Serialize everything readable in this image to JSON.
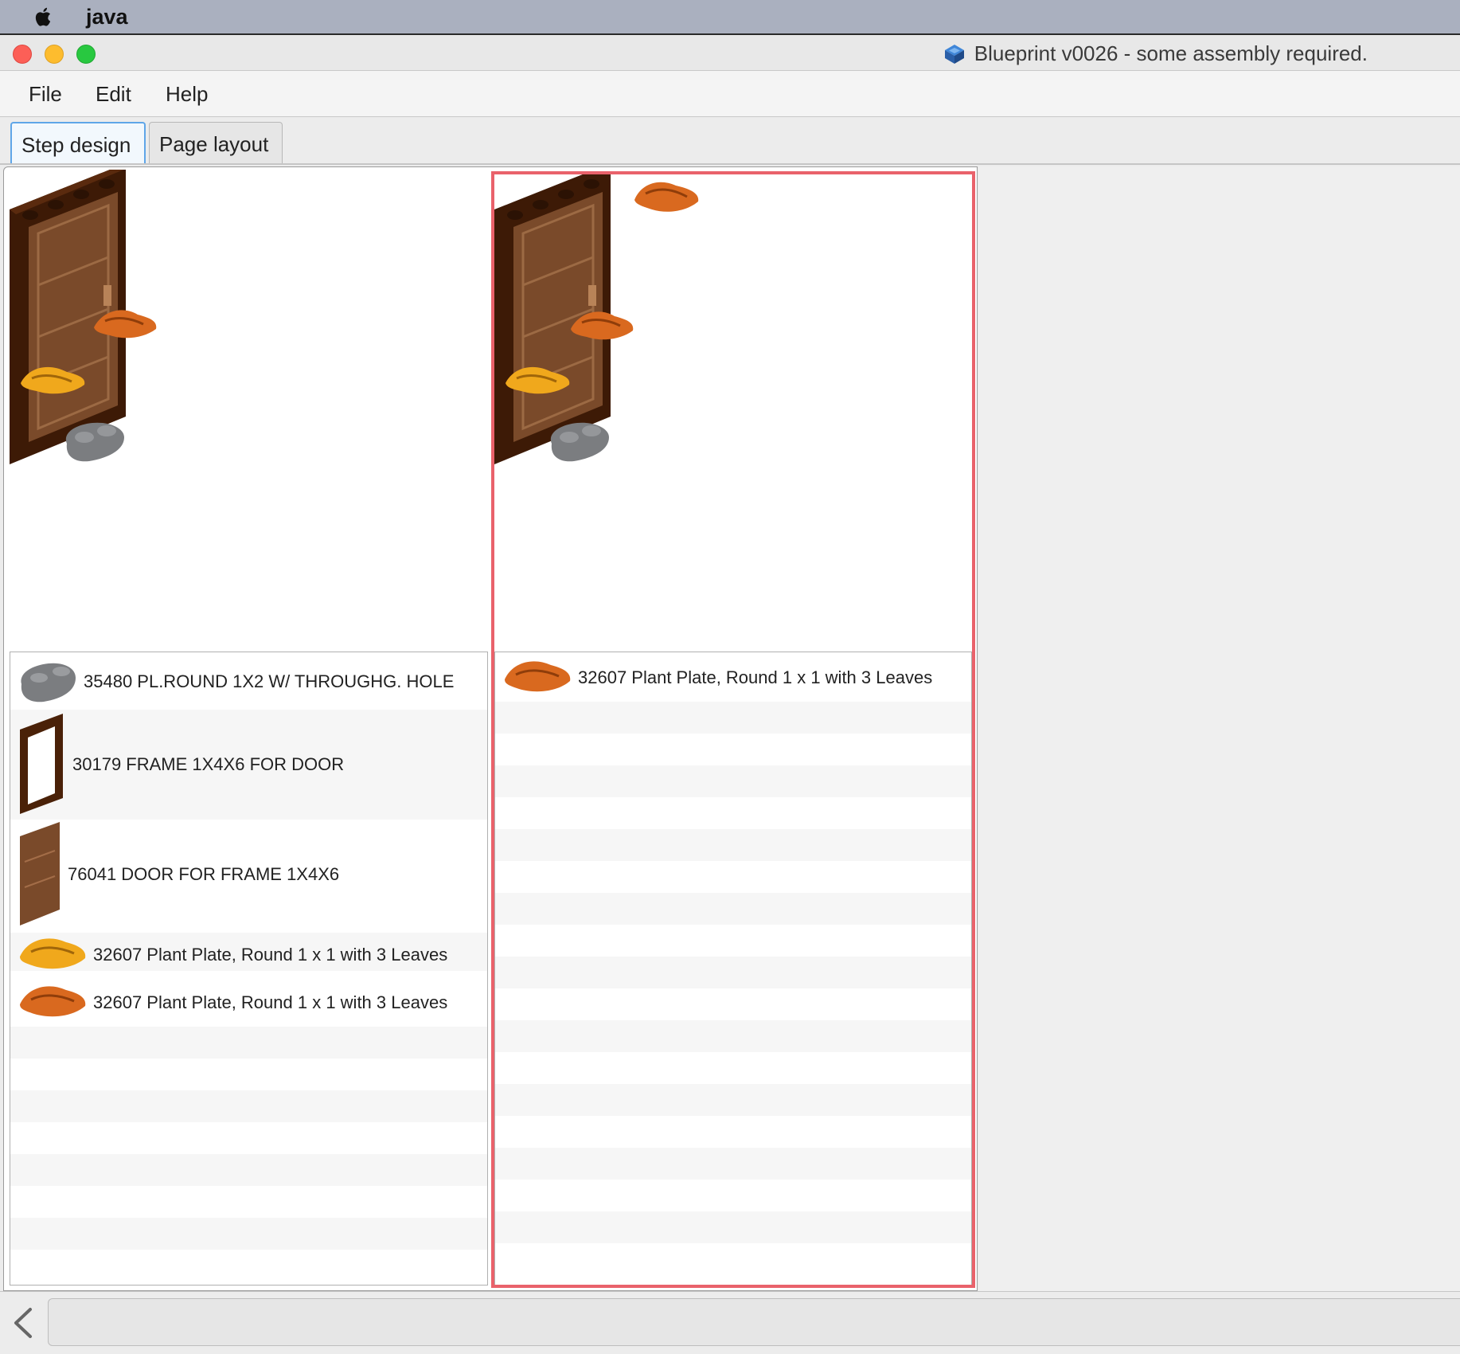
{
  "menubar": {
    "app_name": "java"
  },
  "window": {
    "title": "Blueprint v0026 - some assembly required."
  },
  "menu": {
    "file": "File",
    "edit": "Edit",
    "help": "Help"
  },
  "tabs": [
    {
      "label": "Step design",
      "active": true
    },
    {
      "label": "Page layout",
      "active": false
    }
  ],
  "steps": [
    {
      "parts": [
        {
          "icon": "round-plate-icon",
          "label": "35480 PL.ROUND 1X2 W/ THROUGHG. HOLE"
        },
        {
          "icon": "door-frame-icon",
          "label": "30179 FRAME 1X4X6 FOR DOOR"
        },
        {
          "icon": "door-icon",
          "label": "76041 DOOR FOR FRAME 1X4X6"
        },
        {
          "icon": "plant-leaves-yellow-icon",
          "label": "32607 Plant Plate, Round 1 x 1 with 3 Leaves"
        },
        {
          "icon": "plant-leaves-orange-icon",
          "label": "32607 Plant Plate, Round 1 x 1 with 3 Leaves"
        }
      ]
    },
    {
      "selected": true,
      "parts": [
        {
          "icon": "plant-leaves-orange-icon",
          "label": "32607 Plant Plate, Round 1 x 1 with 3 Leaves"
        }
      ]
    }
  ],
  "colors": {
    "selection": "#e9626b",
    "tab_active": "#5fa6e8",
    "frame_brown": "#4a2108",
    "door_brown": "#7a4a2a",
    "leaf_orange": "#d9691f",
    "leaf_yellow": "#f0a81c",
    "plate_gray": "#7b7d80"
  }
}
